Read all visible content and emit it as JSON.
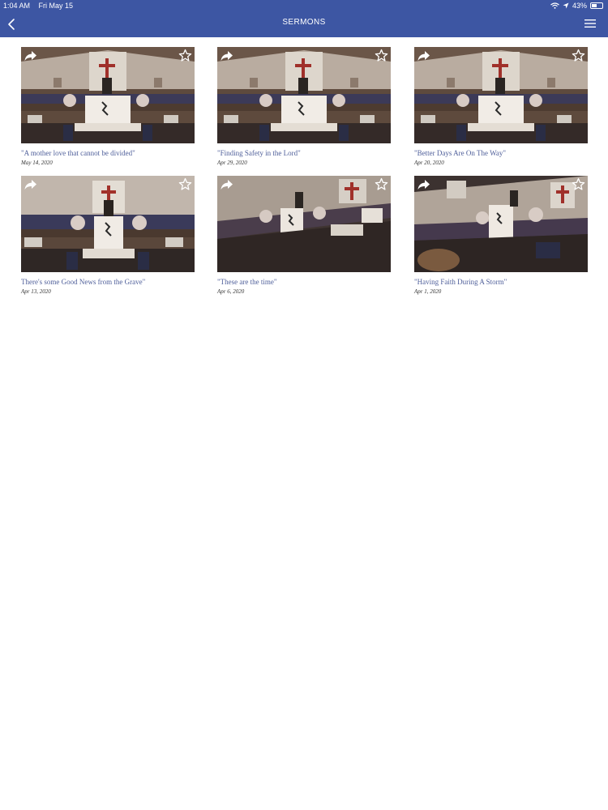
{
  "status_bar": {
    "time": "1:04 AM",
    "date": "Fri May 15",
    "battery": "43%"
  },
  "header": {
    "title": "SERMONS"
  },
  "sermons": [
    {
      "title": "\"A mother love that cannot be divided\"",
      "date": "May 14, 2020"
    },
    {
      "title": "\"Finding Safety in the Lord\"",
      "date": "Apr 29, 2020"
    },
    {
      "title": "\"Better Days Are On The Way\"",
      "date": "Apr 20, 2020"
    },
    {
      "title": "There's some Good News from the Grave\"",
      "date": "Apr 13, 2020"
    },
    {
      "title": "\"These are the time\"",
      "date": "Apr 6, 2020"
    },
    {
      "title": "\"Having Faith During A Storm\"",
      "date": "Apr 1, 2020"
    }
  ],
  "icons": {
    "back": "chevron-left-icon",
    "menu": "hamburger-menu-icon",
    "share": "share-arrow-icon",
    "favorite": "star-outline-icon"
  },
  "colors": {
    "header": "#3d56a3",
    "title_text": "#4f5f9a"
  }
}
